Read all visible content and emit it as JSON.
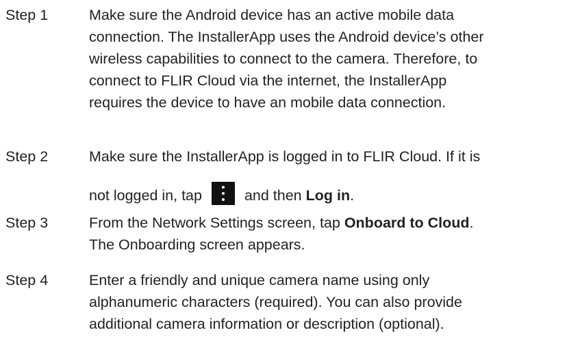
{
  "steps": [
    {
      "label": "Step 1",
      "lines": [
        "Make sure the Android device has an active mobile data",
        "connection. The InstallerApp uses the Android device’s other",
        "wireless capabilities to connect to the camera. Therefore, to",
        "connect to FLIR Cloud via the internet, the InstallerApp",
        "requires the device to have an mobile data connection."
      ]
    },
    {
      "label": "Step 2",
      "line1": "Make sure the InstallerApp is logged in to FLIR Cloud. If it is",
      "line2_before": "not logged in, tap",
      "line2_middle": "and then",
      "line2_bold": "Log in",
      "line2_after": ".",
      "icon": "more-vert-icon"
    },
    {
      "label": "Step 3",
      "line1_before": "From the Network Settings screen, tap",
      "line1_bold": "Onboard to Cloud",
      "line1_after": ".",
      "line2": "The Onboarding screen appears."
    },
    {
      "label": "Step 4",
      "lines": [
        "Enter a friendly and unique camera name using only",
        "alphanumeric characters (required). You can also provide",
        "additional camera information or description (optional)."
      ]
    }
  ]
}
